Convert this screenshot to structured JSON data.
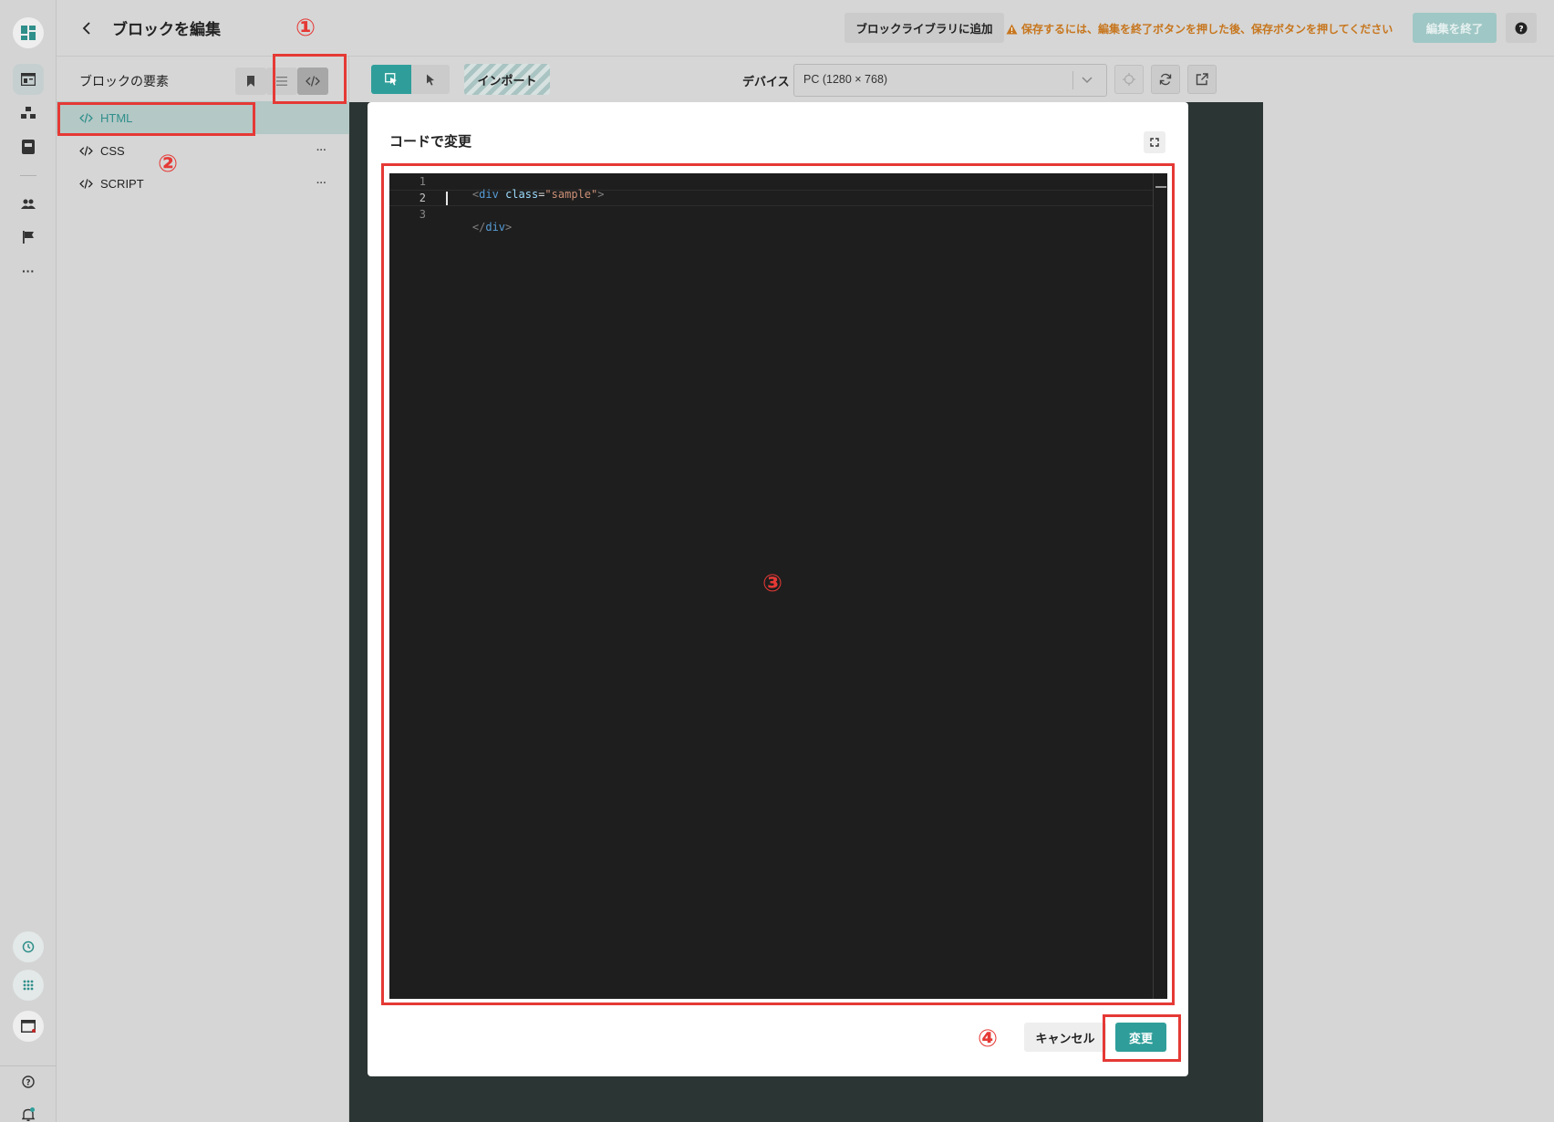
{
  "header": {
    "back_icon": "chevron-left-icon",
    "title": "ブロックを編集",
    "add_library_label": "ブロックライブラリに追加",
    "warning_text": "保存するには、編集を終了ボタンを押した後、保存ボタンを押してください",
    "finish_label": "編集を終了",
    "help_icon": "question-icon"
  },
  "sidepanel": {
    "title": "ブロックの要素",
    "items": [
      {
        "label": "HTML",
        "icon": "code-icon"
      },
      {
        "label": "CSS",
        "icon": "code-icon",
        "more": "···"
      },
      {
        "label": "SCRIPT",
        "icon": "code-icon",
        "more": "···"
      }
    ]
  },
  "toolbar": {
    "import_label": "インポート",
    "device_label": "デバイス",
    "device_value": "PC (1280 × 768)"
  },
  "modal": {
    "title": "コードで変更",
    "cancel_label": "キャンセル",
    "apply_label": "変更"
  },
  "editor": {
    "line_numbers": [
      "1",
      "2",
      "3"
    ],
    "lines": [
      "<div class=\"sample\">",
      "",
      "</div>"
    ]
  },
  "annotations": {
    "one": "①",
    "two": "②",
    "three": "③",
    "four": "④"
  },
  "colors": {
    "accent": "#2f9e9a",
    "warning": "#c7761d",
    "annotation": "#e53935"
  }
}
